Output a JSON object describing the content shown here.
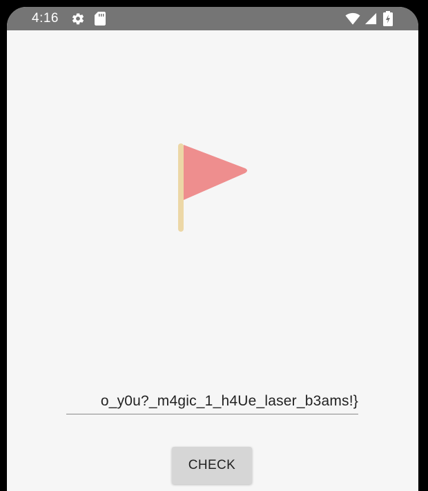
{
  "status_bar": {
    "time": "4:16",
    "icons": [
      "gear-icon",
      "sd-card-icon",
      "wifi-icon",
      "signal-icon",
      "battery-charging-icon"
    ],
    "background_color": "#757575"
  },
  "main": {
    "flag_icon": "flag-icon",
    "flag_color": "#ee8e8e",
    "pole_color": "#ecd7a6",
    "input": {
      "value": "o_y0u?_m4gic_1_h4Ue_laser_b3ams!}"
    },
    "check_button_label": "CHECK"
  }
}
